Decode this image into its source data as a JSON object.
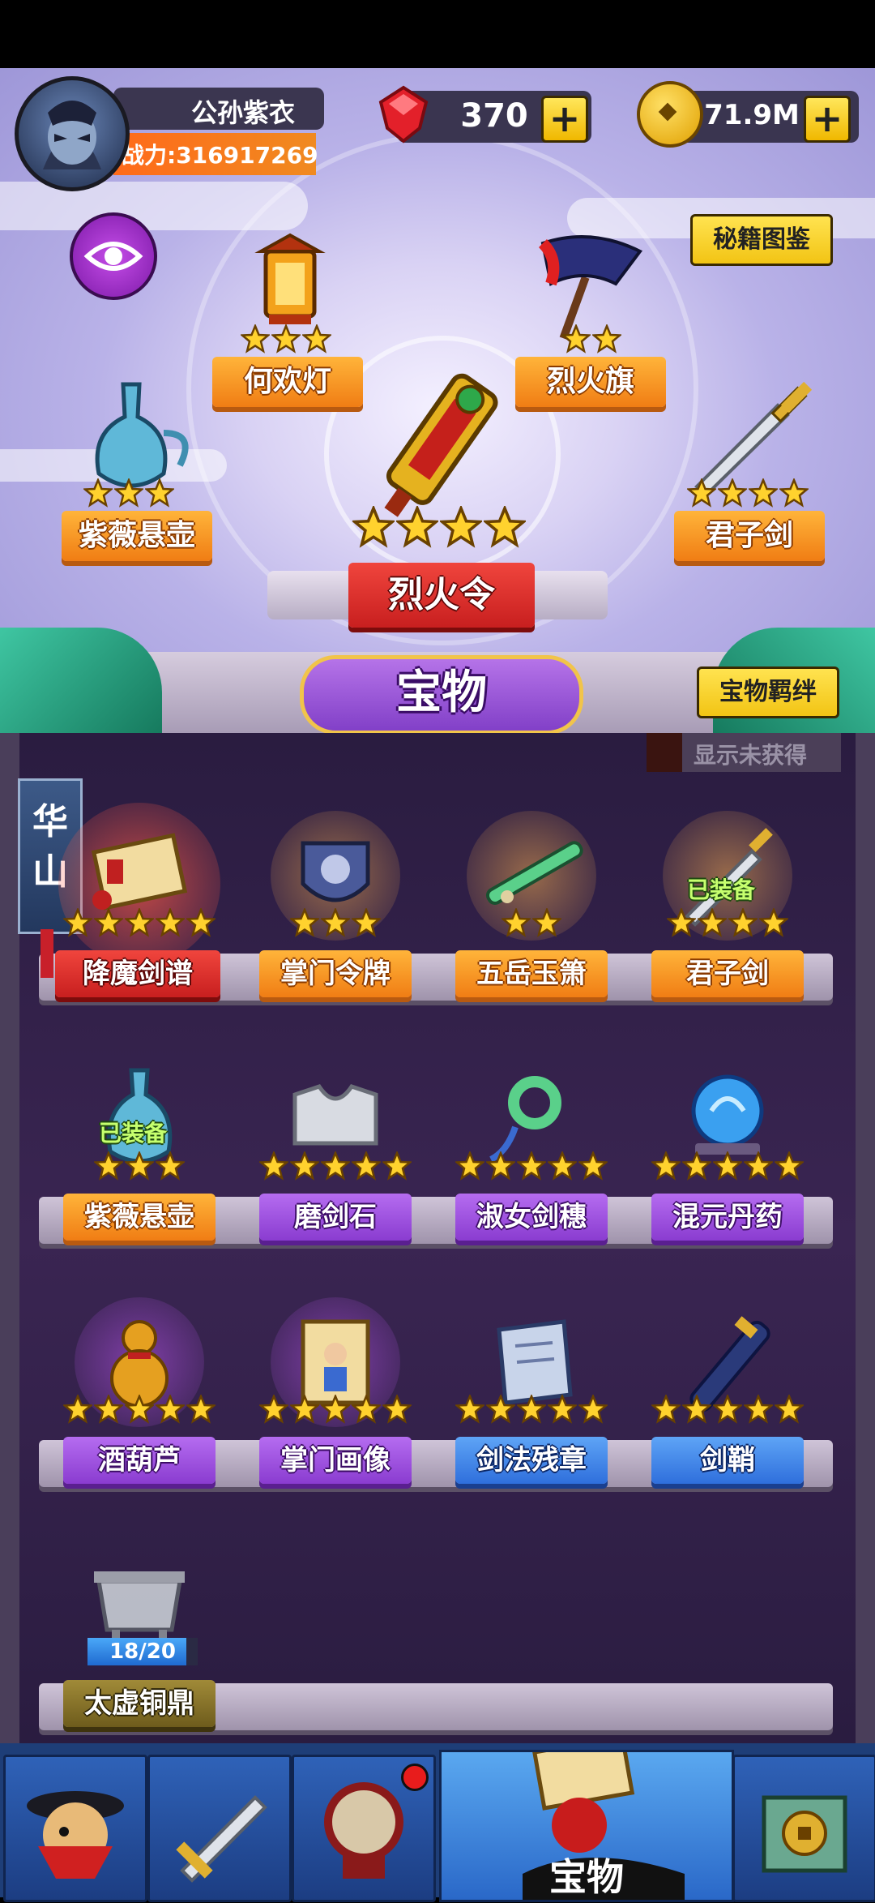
{
  "player": {
    "name": "公孙紫衣",
    "power_label": "战力:",
    "power_value": "31691 7269"
  },
  "currency": {
    "gems": "370",
    "gold": "71.9M",
    "add_symbol": "+"
  },
  "buttons": {
    "codex": "秘籍图鉴",
    "bond": "宝物羁绊",
    "show_unobtained": "显示未获得"
  },
  "featured": {
    "main": {
      "name": "烈火令",
      "stars": 4
    },
    "left_top": {
      "name": "何欢灯",
      "stars": 3
    },
    "right_top": {
      "name": "烈火旗",
      "stars": 2
    },
    "left_mid": {
      "name": "紫薇悬壶",
      "stars": 3
    },
    "right_mid": {
      "name": "君子剑",
      "stars": 4
    }
  },
  "section_title": "宝物",
  "sect_tag": [
    "华",
    "山"
  ],
  "treasures": [
    {
      "name": "降魔剑谱",
      "stars": 5,
      "color": "red",
      "equipped": ""
    },
    {
      "name": "掌门令牌",
      "stars": 3,
      "color": "orange",
      "equipped": ""
    },
    {
      "name": "五岳玉箫",
      "stars": 2,
      "color": "orange",
      "equipped": ""
    },
    {
      "name": "君子剑",
      "stars": 4,
      "color": "orange",
      "equipped": "已装备"
    },
    {
      "name": "紫薇悬壶",
      "stars": 3,
      "color": "orange",
      "equipped": "已装备"
    },
    {
      "name": "磨剑石",
      "stars": 5,
      "color": "purple",
      "equipped": ""
    },
    {
      "name": "淑女剑穗",
      "stars": 5,
      "color": "purple",
      "equipped": ""
    },
    {
      "name": "混元丹药",
      "stars": 5,
      "color": "purple",
      "equipped": ""
    },
    {
      "name": "酒葫芦",
      "stars": 5,
      "color": "purple",
      "equipped": ""
    },
    {
      "name": "掌门画像",
      "stars": 5,
      "color": "purple",
      "equipped": ""
    },
    {
      "name": "剑法残章",
      "stars": 5,
      "color": "blue",
      "equipped": ""
    },
    {
      "name": "剑鞘",
      "stars": 5,
      "color": "blue",
      "equipped": ""
    },
    {
      "name": "太虚铜鼎",
      "stars": 0,
      "color": "olive",
      "equipped": "",
      "progress": "18/20"
    }
  ],
  "nav": {
    "active_label": "宝物",
    "badge_color": "#e81c1c"
  }
}
